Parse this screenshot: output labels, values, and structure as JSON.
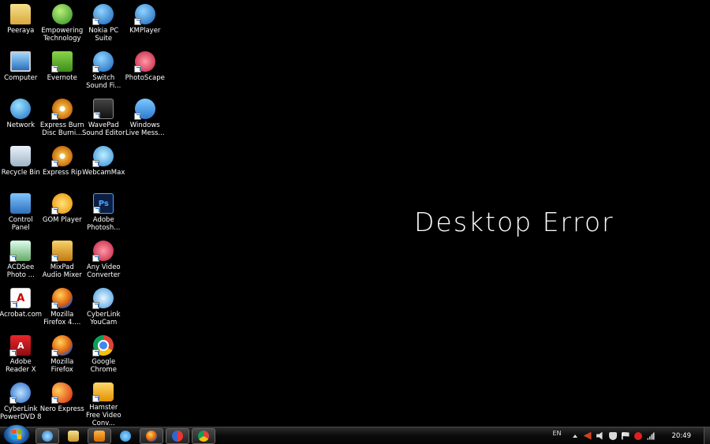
{
  "desktop": {
    "message": "Desktop Error",
    "icons": [
      {
        "label": "Peeraya",
        "icon": "folder-icon",
        "style": "ic-folder",
        "shortcut": false,
        "glyph": ""
      },
      {
        "label": "Empowering Technology",
        "icon": "empowering-technology-icon",
        "style": "ic-green",
        "shortcut": false,
        "glyph": ""
      },
      {
        "label": "Nokia PC Suite",
        "icon": "nokia-pc-suite-icon",
        "style": "ic-blue",
        "shortcut": true,
        "glyph": ""
      },
      {
        "label": "KMPlayer",
        "icon": "kmplayer-icon",
        "style": "ic-blue",
        "shortcut": true,
        "glyph": ""
      },
      {
        "label": "Computer",
        "icon": "computer-icon",
        "style": "ic-monitor",
        "shortcut": false,
        "glyph": ""
      },
      {
        "label": "Evernote",
        "icon": "evernote-icon",
        "style": "ic-evernote",
        "shortcut": true,
        "glyph": ""
      },
      {
        "label": "Switch Sound Fi...",
        "icon": "switch-sound-icon",
        "style": "ic-blue",
        "shortcut": true,
        "glyph": ""
      },
      {
        "label": "PhotoScape",
        "icon": "photoscape-icon",
        "style": "ic-anyvideo",
        "shortcut": true,
        "glyph": ""
      },
      {
        "label": "Network",
        "icon": "network-icon",
        "style": "ic-globe",
        "shortcut": false,
        "glyph": ""
      },
      {
        "label": "Express Burn Disc Burni...",
        "icon": "express-burn-icon",
        "style": "ic-disc",
        "shortcut": true,
        "glyph": ""
      },
      {
        "label": "WavePad Sound Editor",
        "icon": "wavepad-icon",
        "style": "ic-wave",
        "shortcut": true,
        "glyph": ""
      },
      {
        "label": "Windows Live Mess...",
        "icon": "windows-live-messenger-icon",
        "style": "ic-people",
        "shortcut": true,
        "glyph": ""
      },
      {
        "label": "Recycle Bin",
        "icon": "recycle-bin-icon",
        "style": "ic-bin",
        "shortcut": false,
        "glyph": ""
      },
      {
        "label": "Express Rip",
        "icon": "express-rip-icon",
        "style": "ic-disc",
        "shortcut": true,
        "glyph": ""
      },
      {
        "label": "WebcamMax",
        "icon": "webcammax-icon",
        "style": "ic-cam",
        "shortcut": true,
        "glyph": ""
      },
      {
        "label": "",
        "icon": "",
        "style": "",
        "shortcut": false,
        "glyph": "",
        "empty": true
      },
      {
        "label": "Control Panel",
        "icon": "control-panel-icon",
        "style": "ic-panel",
        "shortcut": false,
        "glyph": ""
      },
      {
        "label": "GOM Player",
        "icon": "gom-player-icon",
        "style": "ic-gom",
        "shortcut": true,
        "glyph": ""
      },
      {
        "label": "Adobe Photosh...",
        "icon": "adobe-photoshop-icon",
        "style": "ic-ps",
        "shortcut": true,
        "glyph": "Ps"
      },
      {
        "label": "",
        "icon": "",
        "style": "",
        "shortcut": false,
        "glyph": "",
        "empty": true
      },
      {
        "label": "ACDSee Photo ...",
        "icon": "acdsee-icon",
        "style": "ic-acdsee",
        "shortcut": true,
        "glyph": ""
      },
      {
        "label": "MixPad Audio Mixer",
        "icon": "mixpad-icon",
        "style": "ic-mixpad",
        "shortcut": true,
        "glyph": ""
      },
      {
        "label": "Any Video Converter",
        "icon": "any-video-converter-icon",
        "style": "ic-anyvideo",
        "shortcut": true,
        "glyph": ""
      },
      {
        "label": "",
        "icon": "",
        "style": "",
        "shortcut": false,
        "glyph": "",
        "empty": true
      },
      {
        "label": "Acrobat.com",
        "icon": "acrobat-com-icon",
        "style": "ic-acrobat",
        "shortcut": true,
        "glyph": "A"
      },
      {
        "label": "Mozilla Firefox 4....",
        "icon": "firefox-icon",
        "style": "ic-firefox",
        "shortcut": true,
        "glyph": ""
      },
      {
        "label": "CyberLink YouCam",
        "icon": "cyberlink-youcam-icon",
        "style": "ic-cyberlink",
        "shortcut": true,
        "glyph": ""
      },
      {
        "label": "",
        "icon": "",
        "style": "",
        "shortcut": false,
        "glyph": "",
        "empty": true
      },
      {
        "label": "Adobe Reader X",
        "icon": "adobe-reader-icon",
        "style": "ic-reader",
        "shortcut": true,
        "glyph": "A"
      },
      {
        "label": "Mozilla Firefox",
        "icon": "firefox-icon",
        "style": "ic-firefox",
        "shortcut": true,
        "glyph": ""
      },
      {
        "label": "Google Chrome",
        "icon": "google-chrome-icon",
        "style": "ic-chrome",
        "shortcut": true,
        "glyph": ""
      },
      {
        "label": "",
        "icon": "",
        "style": "",
        "shortcut": false,
        "glyph": "",
        "empty": true
      },
      {
        "label": "CyberLink PowerDVD 8",
        "icon": "cyberlink-powerdvd-icon",
        "style": "ic-powerdvd",
        "shortcut": true,
        "glyph": ""
      },
      {
        "label": "Nero Express",
        "icon": "nero-express-icon",
        "style": "ic-nero",
        "shortcut": true,
        "glyph": ""
      },
      {
        "label": "Hamster Free Video Conv...",
        "icon": "hamster-video-converter-icon",
        "style": "ic-hamster",
        "shortcut": true,
        "glyph": ""
      }
    ]
  },
  "taskbar": {
    "start_icon": "windows-start-icon",
    "buttons": [
      {
        "icon": "internet-explorer-icon",
        "style": "tg-ie",
        "state": "pinned"
      },
      {
        "icon": "windows-explorer-icon",
        "style": "tg-explorer",
        "state": "plain"
      },
      {
        "icon": "media-player-icon",
        "style": "tg-media",
        "state": "pinned"
      },
      {
        "icon": "messenger-icon",
        "style": "tg-messenger",
        "state": "plain"
      },
      {
        "icon": "firefox-icon",
        "style": "tg-firefox",
        "state": "pinned"
      },
      {
        "icon": "photoscape-icon",
        "style": "tg-photoscape",
        "state": "pinned"
      },
      {
        "icon": "google-chrome-icon",
        "style": "tg-chrome",
        "state": "pinned"
      }
    ],
    "tray": {
      "language": "EN",
      "clock": "20:49",
      "icons": [
        "show-hidden-icons-icon",
        "snipping-icon",
        "volume-icon",
        "security-shield-icon",
        "action-center-flag-icon",
        "antivirus-icon",
        "network-signal-icon"
      ]
    }
  }
}
